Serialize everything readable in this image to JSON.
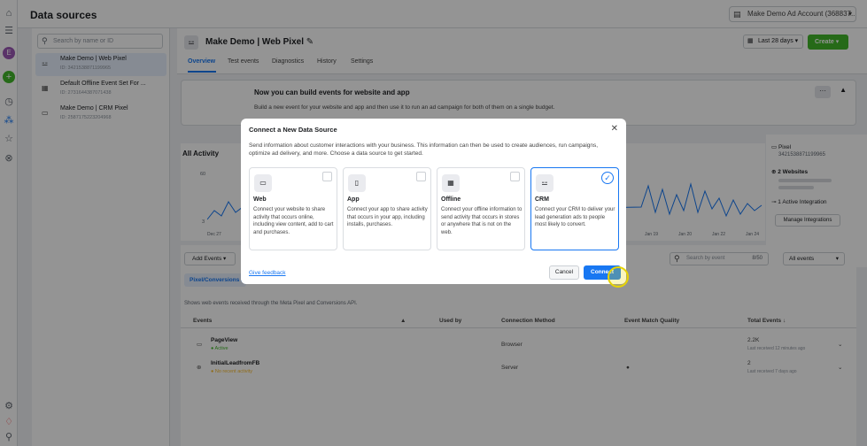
{
  "rail": {
    "icons": [
      "home-icon",
      "menu-icon",
      "profile-icon",
      "add-icon",
      "clock-icon",
      "data-sources-icon",
      "star-icon",
      "link-icon"
    ],
    "bottom_icons": [
      "settings-icon",
      "notifications-icon",
      "search-icon"
    ],
    "profile_initial": "E"
  },
  "topbar": {
    "title": "Data sources",
    "account": "Make Demo Ad Account (368837..."
  },
  "sources": {
    "search_placeholder": "Search by name or ID",
    "items": [
      {
        "name": "Make Demo | Web Pixel",
        "id": "ID: 3421538871199965"
      },
      {
        "name": "Default Offline Event Set For ...",
        "id": "ID: 2731644387071438"
      },
      {
        "name": "Make Demo | CRM Pixel",
        "id": "ID: 2587175223204968"
      }
    ]
  },
  "header": {
    "title": "Make Demo | Web Pixel",
    "tabs": [
      "Overview",
      "Test events",
      "Diagnostics",
      "History",
      "Settings"
    ],
    "daterange": "Last 28 days",
    "create": "Create"
  },
  "banner": {
    "title": "Now you can build events for website and app",
    "subtitle": "Build a new event for your website and app and then use it to run an ad campaign for both of them on a single budget."
  },
  "activity": {
    "title": "All Activity",
    "y_ticks": [
      "60",
      "3"
    ],
    "x_ticks": [
      "Dec 27",
      "Jan 19",
      "Jan 20",
      "Jan 22",
      "Jan 24"
    ]
  },
  "pixel_info": {
    "label": "Pixel",
    "id": "3421538871199965",
    "websites": "2 Websites",
    "integration": "1 Active Integration",
    "manage": "Manage Integrations"
  },
  "events": {
    "add": "Add Events",
    "subtab": "Pixel/Conversions API",
    "search_placeholder": "Search by event",
    "counter": "8/50",
    "filter": "All events",
    "description": "Shows web events received through the Meta Pixel and Conversions API.",
    "columns": [
      "Events",
      "Used by",
      "Connection Method",
      "Event Match Quality",
      "Total Events ↓"
    ],
    "rows": [
      {
        "name": "PageView",
        "status": "Active",
        "method": "Browser",
        "quality": "",
        "total": "2.2K",
        "last": "Last received 12 minutes ago"
      },
      {
        "name": "InitialLeadfromFB",
        "status": "No recent activity",
        "method": "Server",
        "quality": "●",
        "total": "2",
        "last": "Last received 7 days ago"
      }
    ]
  },
  "modal": {
    "title": "Connect a New Data Source",
    "description": "Send information about customer interactions with your business. This information can then be used to create audiences, run campaigns, optimize ad delivery, and more. Choose a data source to get started.",
    "options": [
      {
        "name": "Web",
        "desc": "Connect your website to share activity that occurs online, including view content, add to cart and purchases.",
        "icon": "web-icon"
      },
      {
        "name": "App",
        "desc": "Connect your app to share activity that occurs in your app, including installs, purchases.",
        "icon": "app-icon"
      },
      {
        "name": "Offline",
        "desc": "Connect your offline information to send activity that occurs in stores or anywhere that is not on the web.",
        "icon": "offline-icon"
      },
      {
        "name": "CRM",
        "desc": "Connect your CRM to deliver your lead generation ads to people most likely to convert.",
        "icon": "crm-icon"
      }
    ],
    "selected": "CRM",
    "feedback": "Give feedback",
    "cancel": "Cancel",
    "connect": "Connect"
  },
  "colors": {
    "accent": "#1877f2",
    "create": "#42b72a",
    "overlay": "rgba(0,0,0,0.42)"
  }
}
